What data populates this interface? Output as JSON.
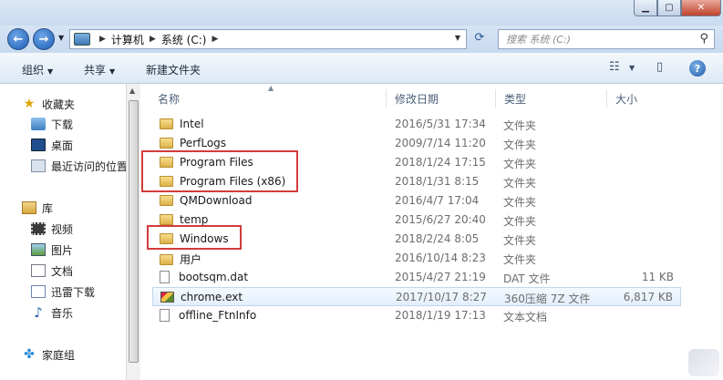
{
  "address": {
    "crumbs": [
      "计算机",
      "系统 (C:)"
    ]
  },
  "search": {
    "placeholder": "搜索 系统 (C:)"
  },
  "toolbar": {
    "organize_label": "组织",
    "share_label": "共享",
    "new_folder_label": "新建文件夹"
  },
  "nav": {
    "favorites": {
      "label": "收藏夹",
      "items": [
        {
          "label": "下载",
          "icon": "download-folder-icon"
        },
        {
          "label": "桌面",
          "icon": "desktop-icon"
        },
        {
          "label": "最近访问的位置",
          "icon": "recent-places-icon"
        }
      ]
    },
    "libraries": {
      "label": "库",
      "items": [
        {
          "label": "视频",
          "icon": "video-library-icon"
        },
        {
          "label": "图片",
          "icon": "picture-library-icon"
        },
        {
          "label": "文档",
          "icon": "document-library-icon"
        },
        {
          "label": "迅雷下载",
          "icon": "thunder-download-icon"
        },
        {
          "label": "音乐",
          "icon": "music-library-icon"
        }
      ]
    },
    "homegroup": {
      "label": "家庭组"
    }
  },
  "columns": {
    "name": "名称",
    "modified": "修改日期",
    "type": "类型",
    "size": "大小"
  },
  "files": [
    {
      "name": "Intel",
      "date": "2016/5/31 17:34",
      "type": "文件夹",
      "size": "",
      "kind": "folder"
    },
    {
      "name": "PerfLogs",
      "date": "2009/7/14 11:20",
      "type": "文件夹",
      "size": "",
      "kind": "folder"
    },
    {
      "name": "Program Files",
      "date": "2018/1/24 17:15",
      "type": "文件夹",
      "size": "",
      "kind": "folder"
    },
    {
      "name": "Program Files (x86)",
      "date": "2018/1/31 8:15",
      "type": "文件夹",
      "size": "",
      "kind": "folder"
    },
    {
      "name": "QMDownload",
      "date": "2016/4/7 17:04",
      "type": "文件夹",
      "size": "",
      "kind": "folder"
    },
    {
      "name": "temp",
      "date": "2015/6/27 20:40",
      "type": "文件夹",
      "size": "",
      "kind": "folder"
    },
    {
      "name": "Windows",
      "date": "2018/2/24 8:05",
      "type": "文件夹",
      "size": "",
      "kind": "folder"
    },
    {
      "name": "用户",
      "date": "2016/10/14 8:23",
      "type": "文件夹",
      "size": "",
      "kind": "folder"
    },
    {
      "name": "bootsqm.dat",
      "date": "2015/4/27 21:19",
      "type": "DAT 文件",
      "size": "11 KB",
      "kind": "file"
    },
    {
      "name": "chrome.ext",
      "date": "2017/10/17 8:27",
      "type": "360压缩 7Z 文件",
      "size": "6,817 KB",
      "kind": "zip",
      "selected": true
    },
    {
      "name": "offline_FtnInfo",
      "date": "2018/1/19 17:13",
      "type": "文本文档",
      "size": "",
      "kind": "file"
    }
  ],
  "colors": {
    "highlight_box": "#d33b3b",
    "selection": "#e3eefb"
  }
}
